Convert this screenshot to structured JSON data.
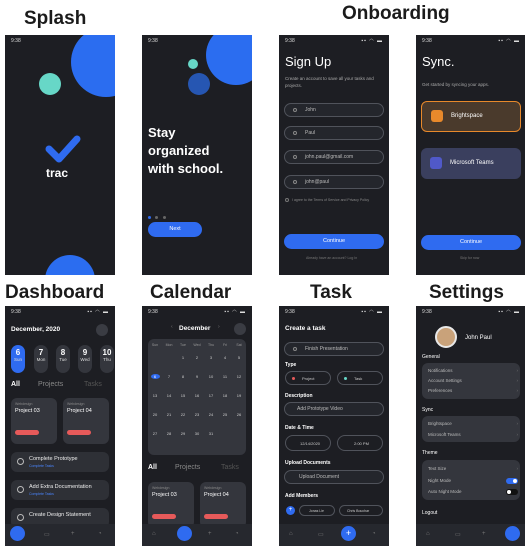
{
  "headings": {
    "splash": "Splash",
    "onboarding": "Onboarding",
    "dashboard": "Dashboard",
    "calendar": "Calendar",
    "task": "Task",
    "settings": "Settings"
  },
  "status": {
    "time": "9:38",
    "icons": "▪▪ ◠ ▬"
  },
  "splash": {
    "logo_text": "trac"
  },
  "intro": {
    "title_l1": "Stay",
    "title_l2": "organized",
    "title_l3": "with school.",
    "button": "Next"
  },
  "signup": {
    "title": "Sign Up",
    "subtitle": "Create an account to save all your tasks and projects.",
    "first": "John",
    "last": "Paul",
    "email": "john.paul@gmail.com",
    "username": "john@paul",
    "terms": "I agree to the Terms of Service and Privacy Policy",
    "button": "Continue",
    "footer": "Already have an account? Log In"
  },
  "sync": {
    "title": "Sync.",
    "subtitle": "Get started by syncing your apps.",
    "app1": "Brightspace",
    "app2": "Microsoft Teams",
    "button": "Continue",
    "footer": "Skip for now"
  },
  "dashboard": {
    "month": "December, 2020",
    "days": [
      {
        "n": "6",
        "d": "Sun"
      },
      {
        "n": "7",
        "d": "Mon"
      },
      {
        "n": "8",
        "d": "Tue"
      },
      {
        "n": "9",
        "d": "Wed"
      },
      {
        "n": "10",
        "d": "Thu"
      }
    ],
    "tab_all": "All",
    "tab_projects": "Projects",
    "tab_tasks": "Tasks",
    "p1_course": "Webdesign",
    "p1": "Project 03",
    "p2_course": "Webdesign",
    "p2": "Project 04",
    "t1": "Complete Prototype",
    "t1s": "Complete Tasks",
    "t2": "Add Extra Documentation",
    "t2s": "Complete Tasks",
    "t3": "Create Design Statement"
  },
  "calendar": {
    "month": "December",
    "weekdays": [
      "Sun",
      "Mon",
      "Tue",
      "Wed",
      "Thu",
      "Fri",
      "Sat"
    ],
    "tab_all": "All",
    "tab_projects": "Projects",
    "tab_tasks": "Tasks",
    "p1_course": "Webdesign",
    "p1": "Project 03",
    "p2_course": "Webdesign",
    "p2": "Project 04"
  },
  "task": {
    "title": "Create a task",
    "name": "Finish Presentation",
    "type_label": "Type",
    "type_project": "Project",
    "type_task": "Task",
    "desc_label": "Description",
    "desc": "Add Prototype Video",
    "dt_label": "Date & Time",
    "date": "12/14/2020",
    "time": "2:00 PM",
    "upload_label": "Upload Documents",
    "upload": "Upload Document",
    "members_label": "Add Members",
    "m1": "Jonas Lie",
    "m2": "Chris Bouchar"
  },
  "settings": {
    "name": "John Paul",
    "general": "General",
    "notifications": "Notifications",
    "account": "Account Settings",
    "preferences": "Preferences",
    "sync": "Sync",
    "brightspace": "Brightspace",
    "teams": "Microsoft Teams",
    "theme": "Theme",
    "text_size": "Text Size",
    "night": "Night Mode",
    "auto_night": "Auto Night Mode",
    "logout": "Logout"
  }
}
